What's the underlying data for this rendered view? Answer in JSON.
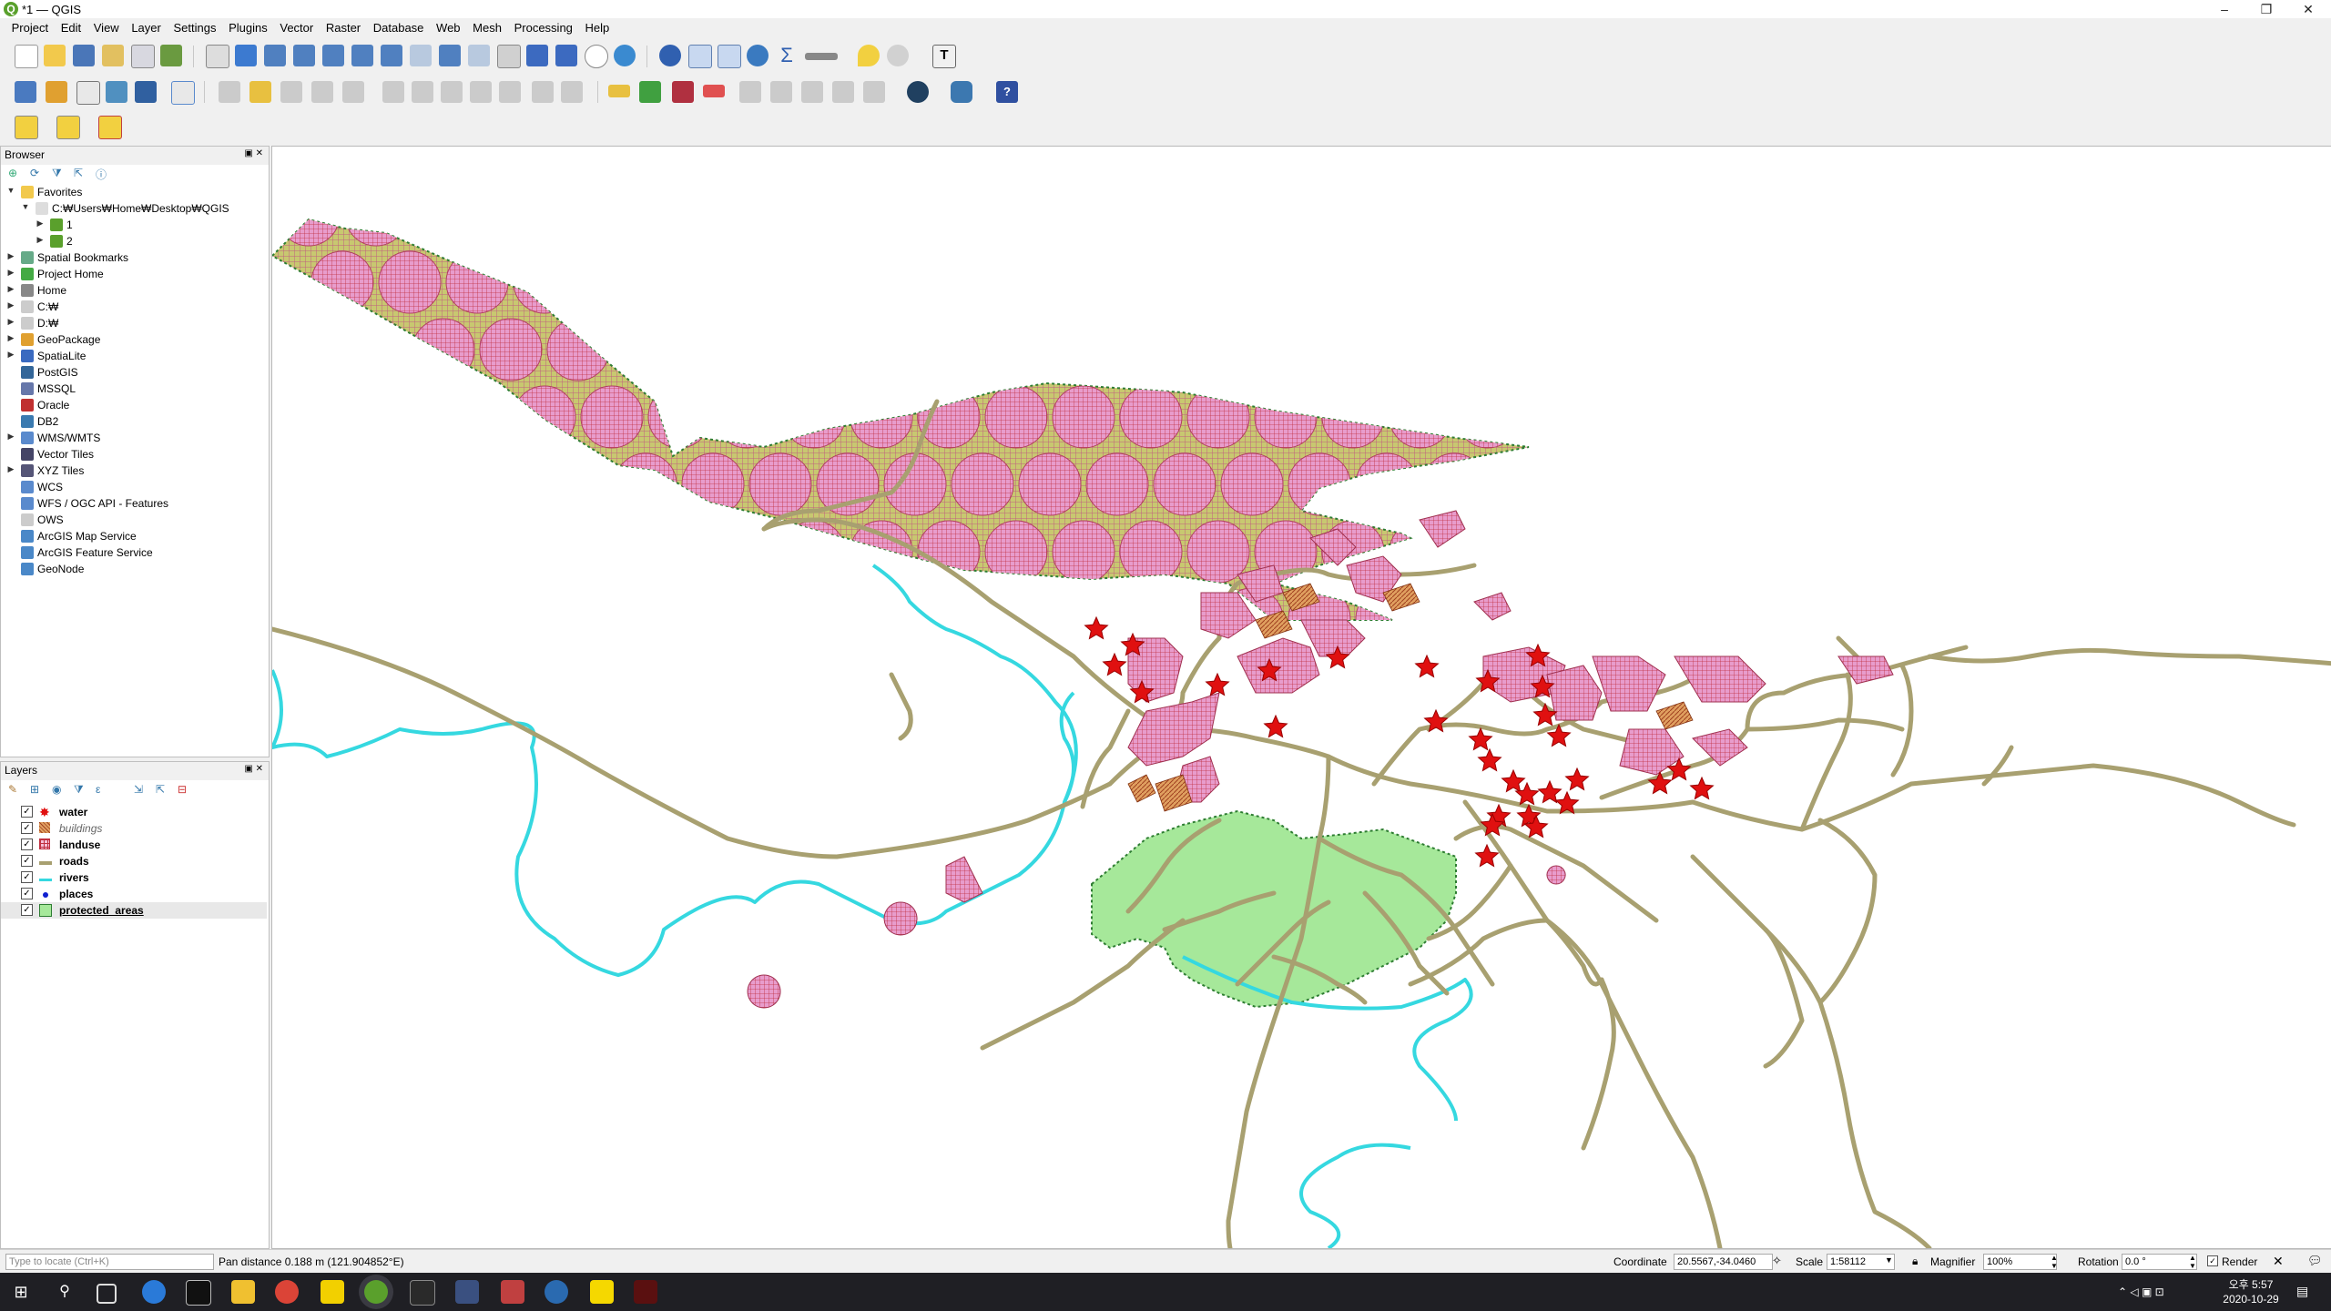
{
  "window": {
    "title": "*1 — QGIS",
    "app_icon": "qgis-icon"
  },
  "menu": [
    "Project",
    "Edit",
    "View",
    "Layer",
    "Settings",
    "Plugins",
    "Vector",
    "Raster",
    "Database",
    "Web",
    "Mesh",
    "Processing",
    "Help"
  ],
  "browser": {
    "title": "Browser",
    "items": [
      {
        "label": "Favorites",
        "icon": "star-icon",
        "expanded": true
      },
      {
        "label": "C:₩Users₩Home₩Desktop₩QGIS",
        "icon": "folder-icon"
      },
      {
        "label": "1",
        "icon": "qgis-project-icon"
      },
      {
        "label": "2",
        "icon": "qgis-project-icon"
      },
      {
        "label": "Spatial Bookmarks",
        "icon": "bookmark-icon"
      },
      {
        "label": "Project Home",
        "icon": "project-home-icon"
      },
      {
        "label": "Home",
        "icon": "home-icon"
      },
      {
        "label": "C:₩",
        "icon": "drive-icon"
      },
      {
        "label": "D:₩",
        "icon": "drive-icon"
      },
      {
        "label": "GeoPackage",
        "icon": "geopackage-icon"
      },
      {
        "label": "SpatiaLite",
        "icon": "spatialite-icon"
      },
      {
        "label": "PostGIS",
        "icon": "postgis-icon"
      },
      {
        "label": "MSSQL",
        "icon": "mssql-icon"
      },
      {
        "label": "Oracle",
        "icon": "oracle-icon"
      },
      {
        "label": "DB2",
        "icon": "db2-icon"
      },
      {
        "label": "WMS/WMTS",
        "icon": "wms-icon"
      },
      {
        "label": "Vector Tiles",
        "icon": "vector-tiles-icon"
      },
      {
        "label": "XYZ Tiles",
        "icon": "xyz-tiles-icon"
      },
      {
        "label": "WCS",
        "icon": "wcs-icon"
      },
      {
        "label": "WFS / OGC API - Features",
        "icon": "wfs-icon"
      },
      {
        "label": "OWS",
        "icon": "ows-icon"
      },
      {
        "label": "ArcGIS Map Service",
        "icon": "arcgis-map-icon"
      },
      {
        "label": "ArcGIS Feature Service",
        "icon": "arcgis-feature-icon"
      },
      {
        "label": "GeoNode",
        "icon": "geonode-icon"
      }
    ]
  },
  "layers": {
    "title": "Layers",
    "items": [
      {
        "label": "water",
        "checked": true,
        "symbol": "red-star"
      },
      {
        "label": "buildings",
        "checked": true,
        "symbol": "orange-hatch",
        "italic": true
      },
      {
        "label": "landuse",
        "checked": true,
        "symbol": "red-grid"
      },
      {
        "label": "roads",
        "checked": true,
        "symbol": "olive-line"
      },
      {
        "label": "rivers",
        "checked": true,
        "symbol": "cyan-line"
      },
      {
        "label": "places",
        "checked": true,
        "symbol": "blue-dot"
      },
      {
        "label": "protected_areas",
        "checked": true,
        "symbol": "green-fill",
        "selected": true
      }
    ]
  },
  "status": {
    "locate_placeholder": "Type to locate (Ctrl+K)",
    "message": "Pan distance 0.188 m (121.904852°E)",
    "coordinate_label": "Coordinate",
    "coordinate_value": "20.5567,-34.0460",
    "scale_label": "Scale",
    "scale_value": "1:58112",
    "magnifier_label": "Magnifier",
    "magnifier_value": "100%",
    "rotation_label": "Rotation",
    "rotation_value": "0.0 °",
    "render_label": "Render"
  },
  "taskbar": {
    "time": "오후 5:57",
    "date": "2020-10-29"
  },
  "colors": {
    "road": "#a8a070",
    "river": "#35d8e0",
    "protected": "#a6e89a",
    "landuse_fill": "#e89ccc",
    "landuse_grid": "#c03040",
    "big_poly": "#c8c870",
    "star": "#e01010"
  }
}
